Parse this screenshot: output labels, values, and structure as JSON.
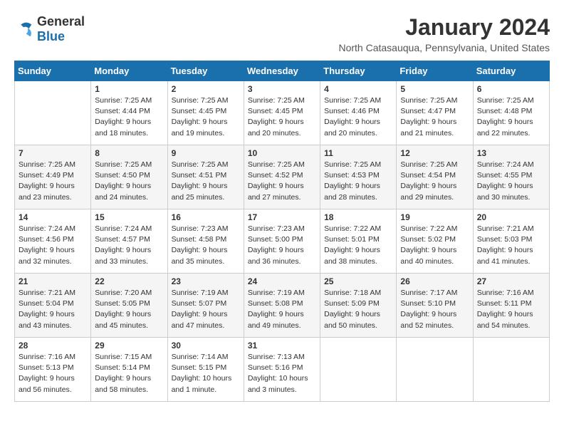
{
  "logo": {
    "general": "General",
    "blue": "Blue"
  },
  "title": "January 2024",
  "subtitle": "North Catasauqua, Pennsylvania, United States",
  "days_of_week": [
    "Sunday",
    "Monday",
    "Tuesday",
    "Wednesday",
    "Thursday",
    "Friday",
    "Saturday"
  ],
  "weeks": [
    [
      {
        "day": "",
        "content": ""
      },
      {
        "day": "1",
        "content": "Sunrise: 7:25 AM\nSunset: 4:44 PM\nDaylight: 9 hours\nand 18 minutes."
      },
      {
        "day": "2",
        "content": "Sunrise: 7:25 AM\nSunset: 4:45 PM\nDaylight: 9 hours\nand 19 minutes."
      },
      {
        "day": "3",
        "content": "Sunrise: 7:25 AM\nSunset: 4:45 PM\nDaylight: 9 hours\nand 20 minutes."
      },
      {
        "day": "4",
        "content": "Sunrise: 7:25 AM\nSunset: 4:46 PM\nDaylight: 9 hours\nand 20 minutes."
      },
      {
        "day": "5",
        "content": "Sunrise: 7:25 AM\nSunset: 4:47 PM\nDaylight: 9 hours\nand 21 minutes."
      },
      {
        "day": "6",
        "content": "Sunrise: 7:25 AM\nSunset: 4:48 PM\nDaylight: 9 hours\nand 22 minutes."
      }
    ],
    [
      {
        "day": "7",
        "content": "Sunrise: 7:25 AM\nSunset: 4:49 PM\nDaylight: 9 hours\nand 23 minutes."
      },
      {
        "day": "8",
        "content": "Sunrise: 7:25 AM\nSunset: 4:50 PM\nDaylight: 9 hours\nand 24 minutes."
      },
      {
        "day": "9",
        "content": "Sunrise: 7:25 AM\nSunset: 4:51 PM\nDaylight: 9 hours\nand 25 minutes."
      },
      {
        "day": "10",
        "content": "Sunrise: 7:25 AM\nSunset: 4:52 PM\nDaylight: 9 hours\nand 27 minutes."
      },
      {
        "day": "11",
        "content": "Sunrise: 7:25 AM\nSunset: 4:53 PM\nDaylight: 9 hours\nand 28 minutes."
      },
      {
        "day": "12",
        "content": "Sunrise: 7:25 AM\nSunset: 4:54 PM\nDaylight: 9 hours\nand 29 minutes."
      },
      {
        "day": "13",
        "content": "Sunrise: 7:24 AM\nSunset: 4:55 PM\nDaylight: 9 hours\nand 30 minutes."
      }
    ],
    [
      {
        "day": "14",
        "content": "Sunrise: 7:24 AM\nSunset: 4:56 PM\nDaylight: 9 hours\nand 32 minutes."
      },
      {
        "day": "15",
        "content": "Sunrise: 7:24 AM\nSunset: 4:57 PM\nDaylight: 9 hours\nand 33 minutes."
      },
      {
        "day": "16",
        "content": "Sunrise: 7:23 AM\nSunset: 4:58 PM\nDaylight: 9 hours\nand 35 minutes."
      },
      {
        "day": "17",
        "content": "Sunrise: 7:23 AM\nSunset: 5:00 PM\nDaylight: 9 hours\nand 36 minutes."
      },
      {
        "day": "18",
        "content": "Sunrise: 7:22 AM\nSunset: 5:01 PM\nDaylight: 9 hours\nand 38 minutes."
      },
      {
        "day": "19",
        "content": "Sunrise: 7:22 AM\nSunset: 5:02 PM\nDaylight: 9 hours\nand 40 minutes."
      },
      {
        "day": "20",
        "content": "Sunrise: 7:21 AM\nSunset: 5:03 PM\nDaylight: 9 hours\nand 41 minutes."
      }
    ],
    [
      {
        "day": "21",
        "content": "Sunrise: 7:21 AM\nSunset: 5:04 PM\nDaylight: 9 hours\nand 43 minutes."
      },
      {
        "day": "22",
        "content": "Sunrise: 7:20 AM\nSunset: 5:05 PM\nDaylight: 9 hours\nand 45 minutes."
      },
      {
        "day": "23",
        "content": "Sunrise: 7:19 AM\nSunset: 5:07 PM\nDaylight: 9 hours\nand 47 minutes."
      },
      {
        "day": "24",
        "content": "Sunrise: 7:19 AM\nSunset: 5:08 PM\nDaylight: 9 hours\nand 49 minutes."
      },
      {
        "day": "25",
        "content": "Sunrise: 7:18 AM\nSunset: 5:09 PM\nDaylight: 9 hours\nand 50 minutes."
      },
      {
        "day": "26",
        "content": "Sunrise: 7:17 AM\nSunset: 5:10 PM\nDaylight: 9 hours\nand 52 minutes."
      },
      {
        "day": "27",
        "content": "Sunrise: 7:16 AM\nSunset: 5:11 PM\nDaylight: 9 hours\nand 54 minutes."
      }
    ],
    [
      {
        "day": "28",
        "content": "Sunrise: 7:16 AM\nSunset: 5:13 PM\nDaylight: 9 hours\nand 56 minutes."
      },
      {
        "day": "29",
        "content": "Sunrise: 7:15 AM\nSunset: 5:14 PM\nDaylight: 9 hours\nand 58 minutes."
      },
      {
        "day": "30",
        "content": "Sunrise: 7:14 AM\nSunset: 5:15 PM\nDaylight: 10 hours\nand 1 minute."
      },
      {
        "day": "31",
        "content": "Sunrise: 7:13 AM\nSunset: 5:16 PM\nDaylight: 10 hours\nand 3 minutes."
      },
      {
        "day": "",
        "content": ""
      },
      {
        "day": "",
        "content": ""
      },
      {
        "day": "",
        "content": ""
      }
    ]
  ]
}
